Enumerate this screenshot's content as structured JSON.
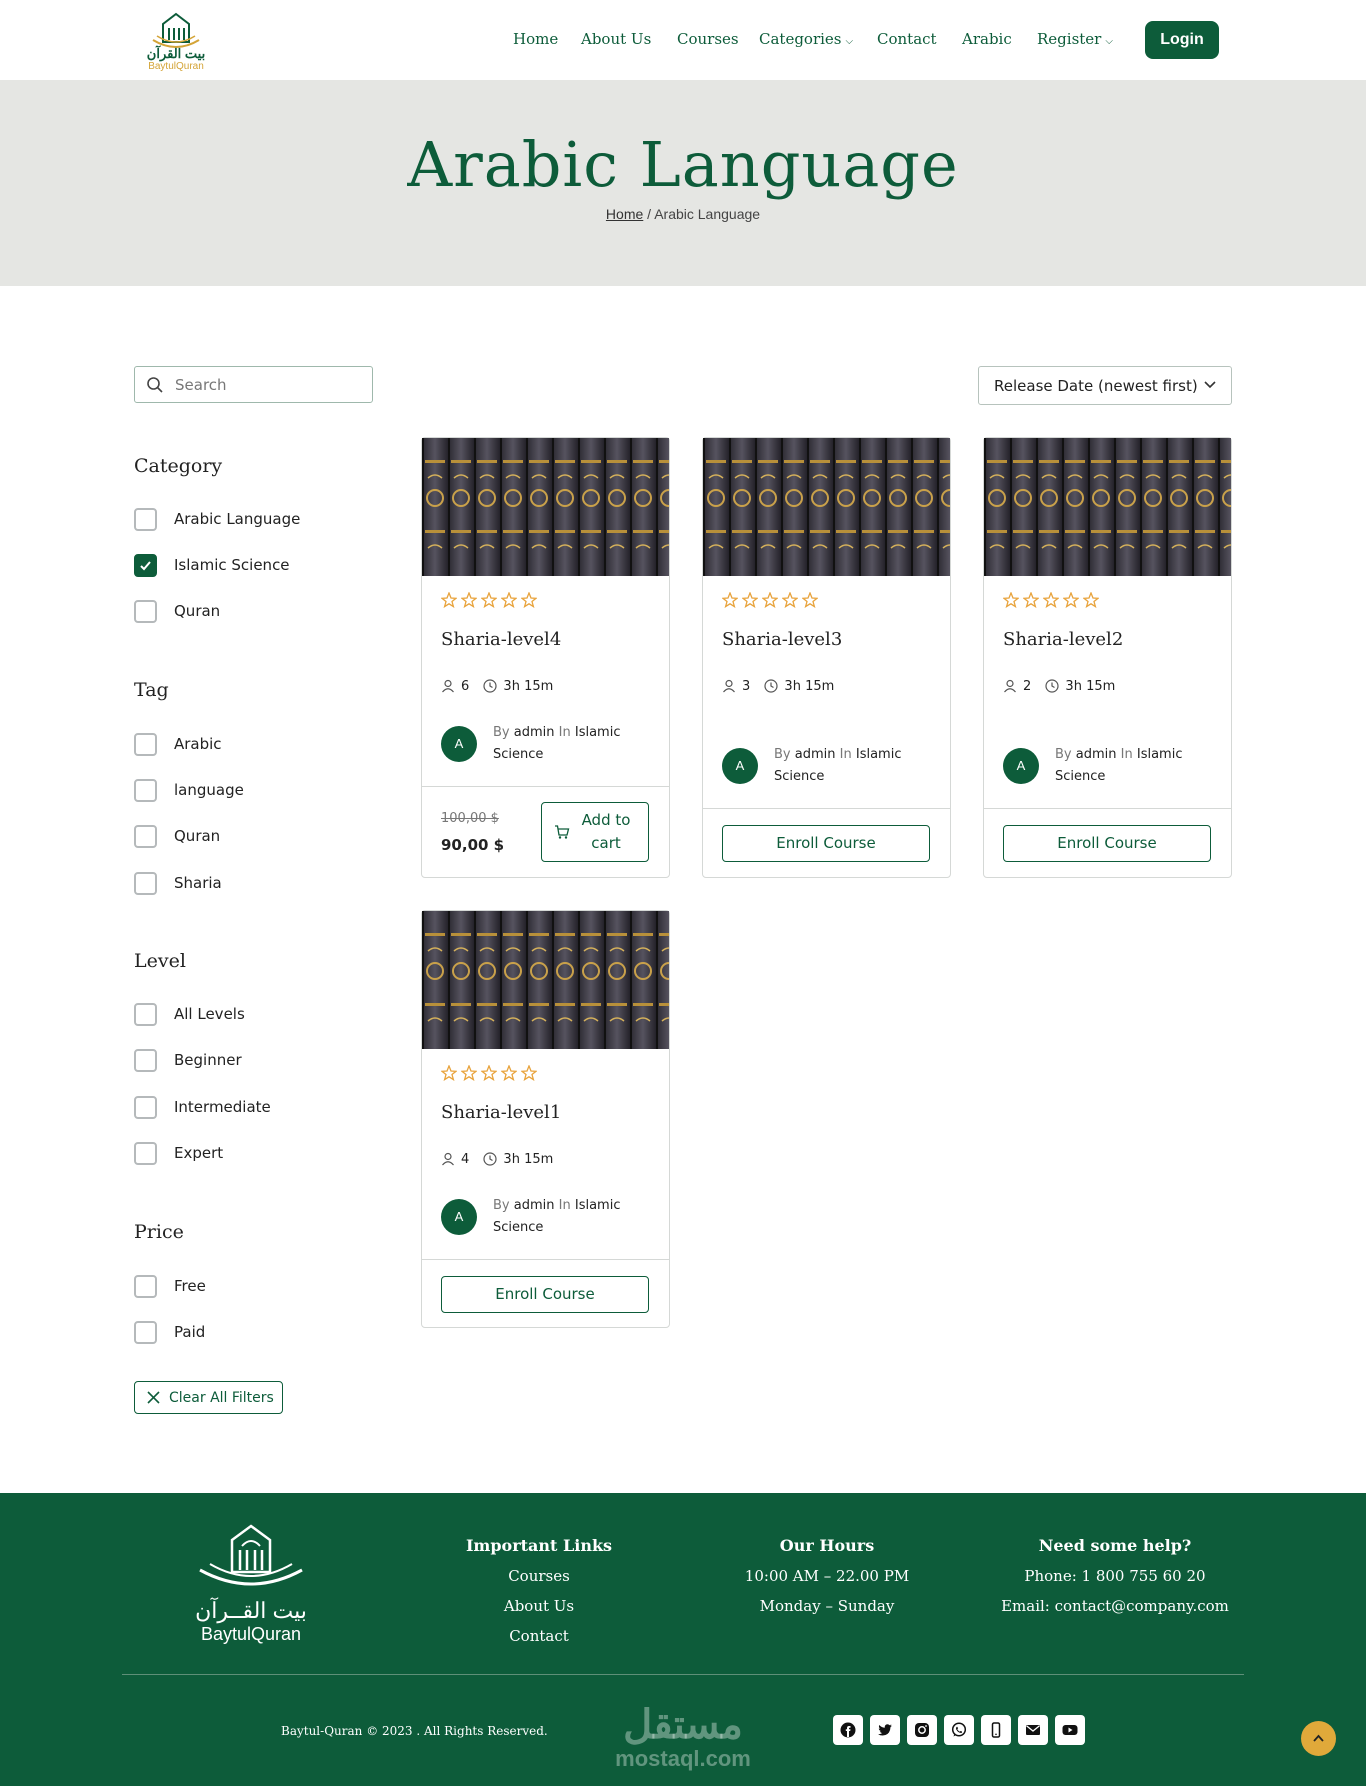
{
  "header": {
    "logo_ar": "بيت القرآن",
    "logo_en": "BaytulQuran",
    "nav": [
      "Home",
      "About Us",
      "Courses",
      "Categories",
      "Contact",
      "Arabic",
      "Register"
    ],
    "login": "Login"
  },
  "hero": {
    "title": "Arabic Language",
    "breadcrumb_home": "Home",
    "breadcrumb_sep": " / ",
    "breadcrumb_current": "Arabic Language"
  },
  "search": {
    "placeholder": "Search"
  },
  "sort": {
    "selected": "Release Date (newest first)"
  },
  "filters": {
    "category": {
      "title": "Category",
      "items": [
        {
          "label": "Arabic Language",
          "checked": false
        },
        {
          "label": "Islamic Science",
          "checked": true
        },
        {
          "label": "Quran",
          "checked": false
        }
      ]
    },
    "tag": {
      "title": "Tag",
      "items": [
        {
          "label": "Arabic",
          "checked": false
        },
        {
          "label": "language",
          "checked": false
        },
        {
          "label": "Quran",
          "checked": false
        },
        {
          "label": "Sharia",
          "checked": false
        }
      ]
    },
    "level": {
      "title": "Level",
      "items": [
        {
          "label": "All Levels",
          "checked": false
        },
        {
          "label": "Beginner",
          "checked": false
        },
        {
          "label": "Intermediate",
          "checked": false
        },
        {
          "label": "Expert",
          "checked": false
        }
      ]
    },
    "price": {
      "title": "Price",
      "items": [
        {
          "label": "Free",
          "checked": false
        },
        {
          "label": "Paid",
          "checked": false
        }
      ]
    },
    "clear": "Clear All Filters"
  },
  "courses": [
    {
      "title": "Sharia-level4",
      "students": "6",
      "duration": "3h 15m",
      "avatar": "A",
      "by": "By",
      "author": "admin",
      "in": "In",
      "category": "Islamic Science",
      "price_old": "100,00 $",
      "price_new": "90,00 $",
      "cart_line1": "Add to",
      "cart_line2": "cart",
      "rating": 0
    },
    {
      "title": "Sharia-level3",
      "students": "3",
      "duration": "3h 15m",
      "avatar": "A",
      "by": "By",
      "author": "admin",
      "in": "In",
      "category": "Islamic Science",
      "enroll": "Enroll Course",
      "rating": 0
    },
    {
      "title": "Sharia-level2",
      "students": "2",
      "duration": "3h 15m",
      "avatar": "A",
      "by": "By",
      "author": "admin",
      "in": "In",
      "category": "Islamic Science",
      "enroll": "Enroll Course",
      "rating": 0
    },
    {
      "title": "Sharia-level1",
      "students": "4",
      "duration": "3h 15m",
      "avatar": "A",
      "by": "By",
      "author": "admin",
      "in": "In",
      "category": "Islamic Science",
      "enroll": "Enroll Course",
      "rating": 0
    }
  ],
  "footer": {
    "logo_ar": "بيت القــرآن",
    "logo_en": "BaytulQuran",
    "links_title": "Important Links",
    "links": [
      "Courses",
      "About Us",
      "Contact"
    ],
    "hours_title": "Our Hours",
    "hours": [
      "10:00 AM – 22.00 PM",
      "Monday – Sunday"
    ],
    "help_title": "Need some help?",
    "help": [
      "Phone: 1 800 755 60 20",
      "Email: contact@company.com"
    ],
    "copyright": "Baytul-Quran © 2023 . All Rights Reserved.",
    "watermark_ar": "مستقل",
    "watermark_en": "mostaql.com",
    "social": [
      "facebook-icon",
      "twitter-icon",
      "instagram-icon",
      "whatsapp-icon",
      "phone-icon",
      "email-icon",
      "youtube-icon"
    ]
  },
  "colors": {
    "primary": "#0d5c3a",
    "accent": "#e0a93a",
    "hero_bg": "#e5e6e3",
    "star": "#e8a33c"
  }
}
